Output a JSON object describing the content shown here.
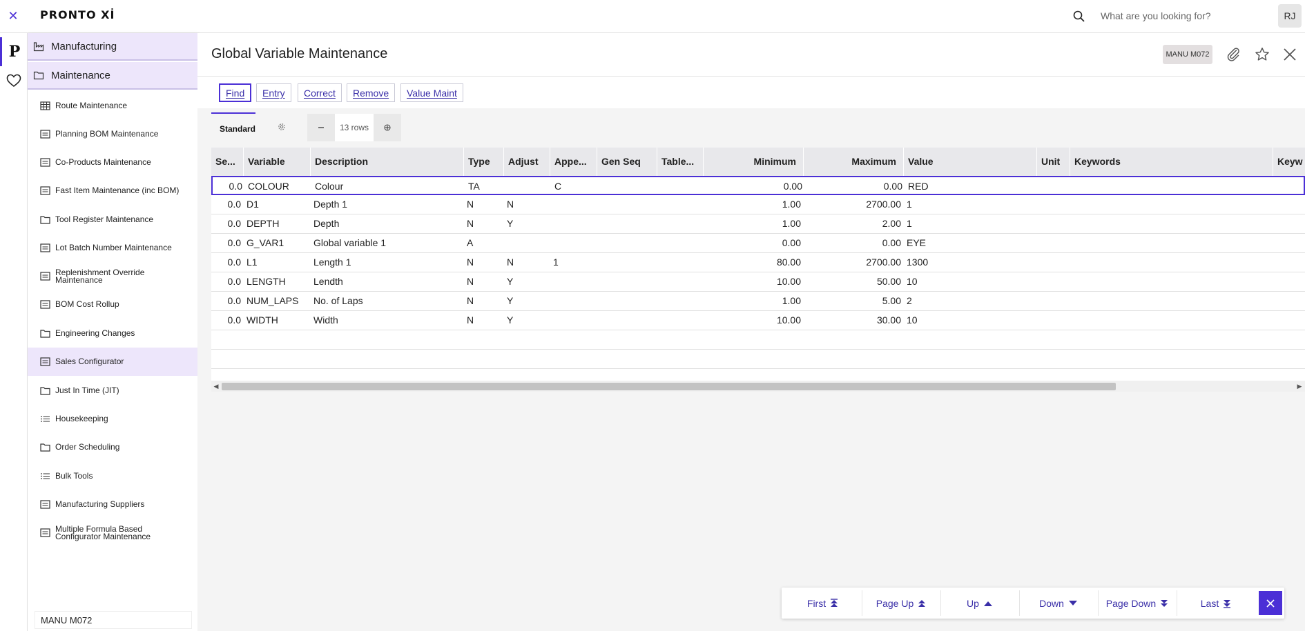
{
  "topbar": {
    "logo": "PRONTO Xİ",
    "search_placeholder": "What are you looking for?",
    "avatar": "RJ"
  },
  "rail": {
    "p_glyph": "P"
  },
  "sidebar": {
    "headers": [
      {
        "label": "Manufacturing",
        "icon": "factory-icon"
      },
      {
        "label": "Maintenance",
        "icon": "folder-icon"
      }
    ],
    "items": [
      {
        "label": "Route Maintenance",
        "icon": "table-icon"
      },
      {
        "label": "Planning BOM Maintenance",
        "icon": "form-icon"
      },
      {
        "label": "Co-Products Maintenance",
        "icon": "form-icon"
      },
      {
        "label": "Fast Item Maintenance (inc BOM)",
        "icon": "form-icon"
      },
      {
        "label": "Tool Register Maintenance",
        "icon": "folder-icon"
      },
      {
        "label": "Lot Batch Number Maintenance",
        "icon": "form-icon"
      },
      {
        "label": "Replenishment Override Maintenance",
        "icon": "form-icon"
      },
      {
        "label": "BOM Cost Rollup",
        "icon": "form-icon"
      },
      {
        "label": "Engineering Changes",
        "icon": "folder-icon"
      },
      {
        "label": "Sales Configurator",
        "icon": "form-icon"
      },
      {
        "label": "Just In Time (JIT)",
        "icon": "folder-icon"
      },
      {
        "label": "Housekeeping",
        "icon": "list-icon"
      },
      {
        "label": "Order Scheduling",
        "icon": "folder-icon"
      },
      {
        "label": "Bulk Tools",
        "icon": "list-icon"
      },
      {
        "label": "Manufacturing Suppliers",
        "icon": "form-icon"
      },
      {
        "label": "Multiple Formula Based Configurator Maintenance",
        "icon": "form-icon"
      }
    ],
    "footer": "MANU M072"
  },
  "main": {
    "title": "Global Variable Maintenance",
    "program_code": "MANU M072",
    "actions": [
      "Find",
      "Entry",
      "Correct",
      "Remove",
      "Value Maint"
    ],
    "view_tab": "Standard",
    "rows_count": "13 rows",
    "columns": [
      "Se...",
      "Variable",
      "Description",
      "Type",
      "Adjust",
      "Appe...",
      "Gen Seq",
      "Table...",
      "Minimum",
      "Maximum",
      "Value",
      "Unit",
      "Keywords",
      "Keyw"
    ],
    "rows": [
      [
        "0.0",
        "COLOUR",
        "Colour",
        "TA",
        "",
        "C",
        "",
        "",
        "0.00",
        "0.00",
        "RED",
        "",
        ""
      ],
      [
        "0.0",
        "D1",
        "Depth 1",
        "N",
        "N",
        "",
        "",
        "",
        "1.00",
        "2700.00",
        "1",
        "",
        ""
      ],
      [
        "0.0",
        "DEPTH",
        "Depth",
        "N",
        "Y",
        "",
        "",
        "",
        "1.00",
        "2.00",
        "1",
        "",
        ""
      ],
      [
        "0.0",
        "G_VAR1",
        "Global variable 1",
        "A",
        "",
        "",
        "",
        "",
        "0.00",
        "0.00",
        "EYE",
        "",
        ""
      ],
      [
        "0.0",
        "L1",
        "Length 1",
        "N",
        "N",
        "1",
        "",
        "",
        "80.00",
        "2700.00",
        "1300",
        "",
        ""
      ],
      [
        "0.0",
        "LENGTH",
        "Lendth",
        "N",
        "Y",
        "",
        "",
        "",
        "10.00",
        "50.00",
        "10",
        "",
        ""
      ],
      [
        "0.0",
        "NUM_LAPS",
        "No. of Laps",
        "N",
        "Y",
        "",
        "",
        "",
        "1.00",
        "5.00",
        "2",
        "",
        ""
      ],
      [
        "0.0",
        "WIDTH",
        "Width",
        "N",
        "Y",
        "",
        "",
        "",
        "10.00",
        "30.00",
        "10",
        "",
        ""
      ],
      [
        "",
        "",
        "",
        "",
        "",
        "",
        "",
        "",
        "",
        "",
        "",
        "",
        ""
      ],
      [
        "",
        "",
        "",
        "",
        "",
        "",
        "",
        "",
        "",
        "",
        "",
        "",
        ""
      ],
      [
        "",
        "",
        "",
        "",
        "",
        "",
        "",
        "",
        "",
        "",
        "",
        "",
        ""
      ],
      [
        "",
        "",
        "",
        "",
        "",
        "",
        "",
        "",
        "",
        "",
        "",
        "",
        ""
      ]
    ]
  },
  "pager": {
    "first": "First",
    "page_up": "Page Up",
    "up": "Up",
    "down": "Down",
    "page_down": "Page Down",
    "last": "Last"
  },
  "colors": {
    "accent": "#4b2fd6",
    "sidebar_highlight": "#ede6fb"
  }
}
